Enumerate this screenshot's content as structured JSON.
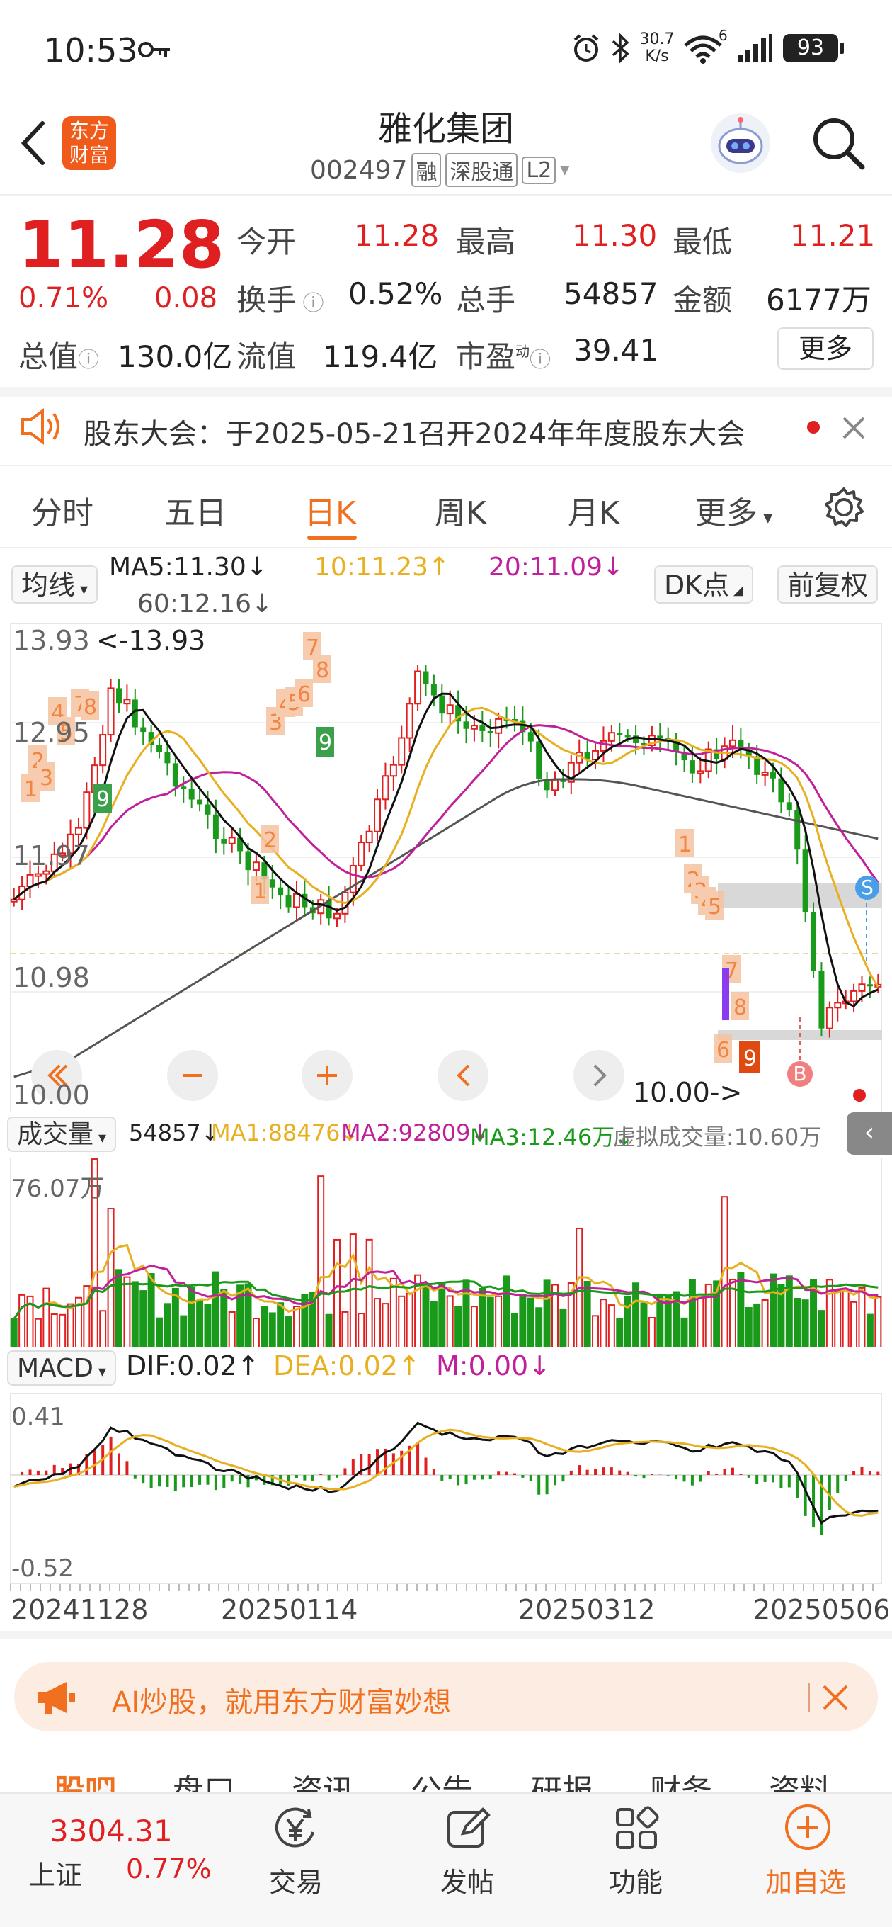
{
  "status": {
    "time": "10:53",
    "net_speed_top": "30.7",
    "net_speed_bottom": "K/s",
    "net_type": "6",
    "battery": "93"
  },
  "header": {
    "logo_line1": "东方",
    "logo_line2": "财富",
    "name": "雅化集团",
    "code": "002497",
    "badge1": "融",
    "badge2": "深股通",
    "badge3": "L2"
  },
  "quote": {
    "price": "11.28",
    "change_pct": "0.71%",
    "change": "0.08",
    "open_label": "今开",
    "open": "11.28",
    "high_label": "最高",
    "high": "11.30",
    "low_label": "最低",
    "low": "11.21",
    "turnover_label": "换手",
    "turnover": "0.52%",
    "volume_label": "总手",
    "volume": "54857",
    "amount_label": "金额",
    "amount": "6177万",
    "mktcap_label": "总值",
    "mktcap": "130.0亿",
    "float_label": "流值",
    "float": "119.4亿",
    "pe_label": "市盈",
    "pe_sup": "动",
    "pe": "39.41",
    "more_label": "更多"
  },
  "notice": {
    "text": "股东大会：于2025-05-21召开2024年年度股东大会"
  },
  "tabs": [
    "分时",
    "五日",
    "日K",
    "周K",
    "月K",
    "更多"
  ],
  "ma": {
    "type": "均线",
    "ma5": "MA5:11.30↓",
    "ma10": "10:11.23↑",
    "ma20": "20:11.09↓",
    "ma60": "60:12.16↓",
    "dk": "DK点",
    "adj": "前复权"
  },
  "kline": {
    "top_price": "13.93",
    "hi_label": "<-13.93",
    "p2": "12.95",
    "p3": "11.97",
    "p4": "10.98",
    "bottom_price": "10.00",
    "lo_label": "10.00->",
    "s_mark": "S",
    "b_mark": "B"
  },
  "volume": {
    "type": "成交量",
    "vol": "54857↓",
    "ma1": "MA1:88476↓",
    "ma2": "MA2:92809↓",
    "ma3": "MA3:12.46万↓",
    "virtual": "虚拟成交量:10.60万",
    "max": "76.07万"
  },
  "macd": {
    "type": "MACD",
    "dif": "DIF:0.02↑",
    "dea": "DEA:0.02↑",
    "m": "M:0.00↓",
    "top": "0.41",
    "bottom": "-0.52"
  },
  "dates": [
    "20241128",
    "20250114",
    "20250312",
    "20250506"
  ],
  "ad": {
    "text": "AI炒股，就用东方财富妙想"
  },
  "subtabs": [
    "股吧",
    "盘口",
    "资讯",
    "公告",
    "研报",
    "财务",
    "资料"
  ],
  "bottom_nav": {
    "index_value": "3304.31",
    "index_name": "上证",
    "index_pct": "0.77%",
    "trade": "交易",
    "post": "发帖",
    "func": "功能",
    "add": "加自选"
  },
  "colors": {
    "up": "#e02020",
    "down": "#1a9a1a",
    "accent": "#f07020"
  }
}
